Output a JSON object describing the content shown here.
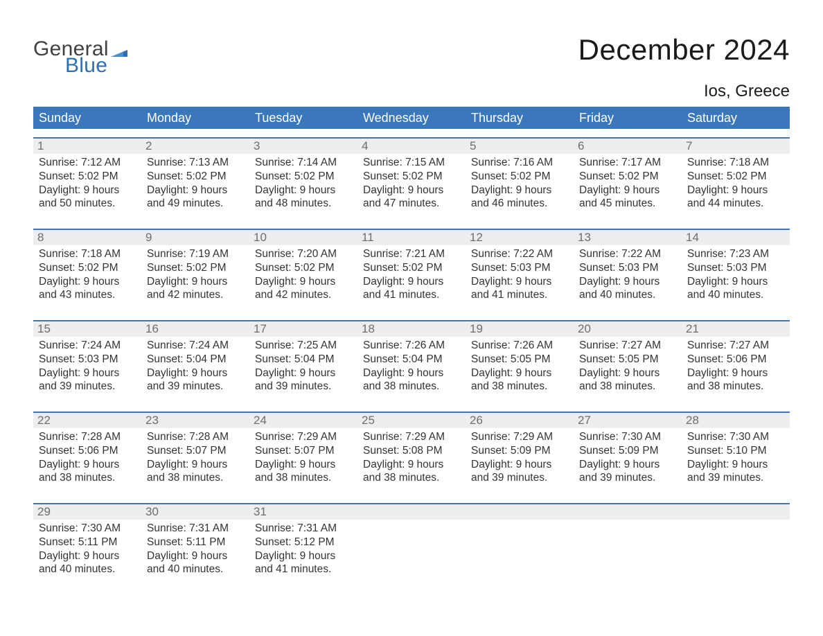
{
  "brand": {
    "word1": "General",
    "word2": "Blue"
  },
  "title": "December 2024",
  "location": "Ios, Greece",
  "colors": {
    "accent": "#3a78bb",
    "logo_blue": "#2d6fb4",
    "day_header_bg": "#eceded"
  },
  "weekdays": [
    "Sunday",
    "Monday",
    "Tuesday",
    "Wednesday",
    "Thursday",
    "Friday",
    "Saturday"
  ],
  "weeks": [
    [
      {
        "n": "1",
        "sr": "Sunrise: 7:12 AM",
        "ss": "Sunset: 5:02 PM",
        "d1": "Daylight: 9 hours",
        "d2": "and 50 minutes."
      },
      {
        "n": "2",
        "sr": "Sunrise: 7:13 AM",
        "ss": "Sunset: 5:02 PM",
        "d1": "Daylight: 9 hours",
        "d2": "and 49 minutes."
      },
      {
        "n": "3",
        "sr": "Sunrise: 7:14 AM",
        "ss": "Sunset: 5:02 PM",
        "d1": "Daylight: 9 hours",
        "d2": "and 48 minutes."
      },
      {
        "n": "4",
        "sr": "Sunrise: 7:15 AM",
        "ss": "Sunset: 5:02 PM",
        "d1": "Daylight: 9 hours",
        "d2": "and 47 minutes."
      },
      {
        "n": "5",
        "sr": "Sunrise: 7:16 AM",
        "ss": "Sunset: 5:02 PM",
        "d1": "Daylight: 9 hours",
        "d2": "and 46 minutes."
      },
      {
        "n": "6",
        "sr": "Sunrise: 7:17 AM",
        "ss": "Sunset: 5:02 PM",
        "d1": "Daylight: 9 hours",
        "d2": "and 45 minutes."
      },
      {
        "n": "7",
        "sr": "Sunrise: 7:18 AM",
        "ss": "Sunset: 5:02 PM",
        "d1": "Daylight: 9 hours",
        "d2": "and 44 minutes."
      }
    ],
    [
      {
        "n": "8",
        "sr": "Sunrise: 7:18 AM",
        "ss": "Sunset: 5:02 PM",
        "d1": "Daylight: 9 hours",
        "d2": "and 43 minutes."
      },
      {
        "n": "9",
        "sr": "Sunrise: 7:19 AM",
        "ss": "Sunset: 5:02 PM",
        "d1": "Daylight: 9 hours",
        "d2": "and 42 minutes."
      },
      {
        "n": "10",
        "sr": "Sunrise: 7:20 AM",
        "ss": "Sunset: 5:02 PM",
        "d1": "Daylight: 9 hours",
        "d2": "and 42 minutes."
      },
      {
        "n": "11",
        "sr": "Sunrise: 7:21 AM",
        "ss": "Sunset: 5:02 PM",
        "d1": "Daylight: 9 hours",
        "d2": "and 41 minutes."
      },
      {
        "n": "12",
        "sr": "Sunrise: 7:22 AM",
        "ss": "Sunset: 5:03 PM",
        "d1": "Daylight: 9 hours",
        "d2": "and 41 minutes."
      },
      {
        "n": "13",
        "sr": "Sunrise: 7:22 AM",
        "ss": "Sunset: 5:03 PM",
        "d1": "Daylight: 9 hours",
        "d2": "and 40 minutes."
      },
      {
        "n": "14",
        "sr": "Sunrise: 7:23 AM",
        "ss": "Sunset: 5:03 PM",
        "d1": "Daylight: 9 hours",
        "d2": "and 40 minutes."
      }
    ],
    [
      {
        "n": "15",
        "sr": "Sunrise: 7:24 AM",
        "ss": "Sunset: 5:03 PM",
        "d1": "Daylight: 9 hours",
        "d2": "and 39 minutes."
      },
      {
        "n": "16",
        "sr": "Sunrise: 7:24 AM",
        "ss": "Sunset: 5:04 PM",
        "d1": "Daylight: 9 hours",
        "d2": "and 39 minutes."
      },
      {
        "n": "17",
        "sr": "Sunrise: 7:25 AM",
        "ss": "Sunset: 5:04 PM",
        "d1": "Daylight: 9 hours",
        "d2": "and 39 minutes."
      },
      {
        "n": "18",
        "sr": "Sunrise: 7:26 AM",
        "ss": "Sunset: 5:04 PM",
        "d1": "Daylight: 9 hours",
        "d2": "and 38 minutes."
      },
      {
        "n": "19",
        "sr": "Sunrise: 7:26 AM",
        "ss": "Sunset: 5:05 PM",
        "d1": "Daylight: 9 hours",
        "d2": "and 38 minutes."
      },
      {
        "n": "20",
        "sr": "Sunrise: 7:27 AM",
        "ss": "Sunset: 5:05 PM",
        "d1": "Daylight: 9 hours",
        "d2": "and 38 minutes."
      },
      {
        "n": "21",
        "sr": "Sunrise: 7:27 AM",
        "ss": "Sunset: 5:06 PM",
        "d1": "Daylight: 9 hours",
        "d2": "and 38 minutes."
      }
    ],
    [
      {
        "n": "22",
        "sr": "Sunrise: 7:28 AM",
        "ss": "Sunset: 5:06 PM",
        "d1": "Daylight: 9 hours",
        "d2": "and 38 minutes."
      },
      {
        "n": "23",
        "sr": "Sunrise: 7:28 AM",
        "ss": "Sunset: 5:07 PM",
        "d1": "Daylight: 9 hours",
        "d2": "and 38 minutes."
      },
      {
        "n": "24",
        "sr": "Sunrise: 7:29 AM",
        "ss": "Sunset: 5:07 PM",
        "d1": "Daylight: 9 hours",
        "d2": "and 38 minutes."
      },
      {
        "n": "25",
        "sr": "Sunrise: 7:29 AM",
        "ss": "Sunset: 5:08 PM",
        "d1": "Daylight: 9 hours",
        "d2": "and 38 minutes."
      },
      {
        "n": "26",
        "sr": "Sunrise: 7:29 AM",
        "ss": "Sunset: 5:09 PM",
        "d1": "Daylight: 9 hours",
        "d2": "and 39 minutes."
      },
      {
        "n": "27",
        "sr": "Sunrise: 7:30 AM",
        "ss": "Sunset: 5:09 PM",
        "d1": "Daylight: 9 hours",
        "d2": "and 39 minutes."
      },
      {
        "n": "28",
        "sr": "Sunrise: 7:30 AM",
        "ss": "Sunset: 5:10 PM",
        "d1": "Daylight: 9 hours",
        "d2": "and 39 minutes."
      }
    ],
    [
      {
        "n": "29",
        "sr": "Sunrise: 7:30 AM",
        "ss": "Sunset: 5:11 PM",
        "d1": "Daylight: 9 hours",
        "d2": "and 40 minutes."
      },
      {
        "n": "30",
        "sr": "Sunrise: 7:31 AM",
        "ss": "Sunset: 5:11 PM",
        "d1": "Daylight: 9 hours",
        "d2": "and 40 minutes."
      },
      {
        "n": "31",
        "sr": "Sunrise: 7:31 AM",
        "ss": "Sunset: 5:12 PM",
        "d1": "Daylight: 9 hours",
        "d2": "and 41 minutes."
      },
      {
        "n": "",
        "sr": "",
        "ss": "",
        "d1": "",
        "d2": ""
      },
      {
        "n": "",
        "sr": "",
        "ss": "",
        "d1": "",
        "d2": ""
      },
      {
        "n": "",
        "sr": "",
        "ss": "",
        "d1": "",
        "d2": ""
      },
      {
        "n": "",
        "sr": "",
        "ss": "",
        "d1": "",
        "d2": ""
      }
    ]
  ]
}
